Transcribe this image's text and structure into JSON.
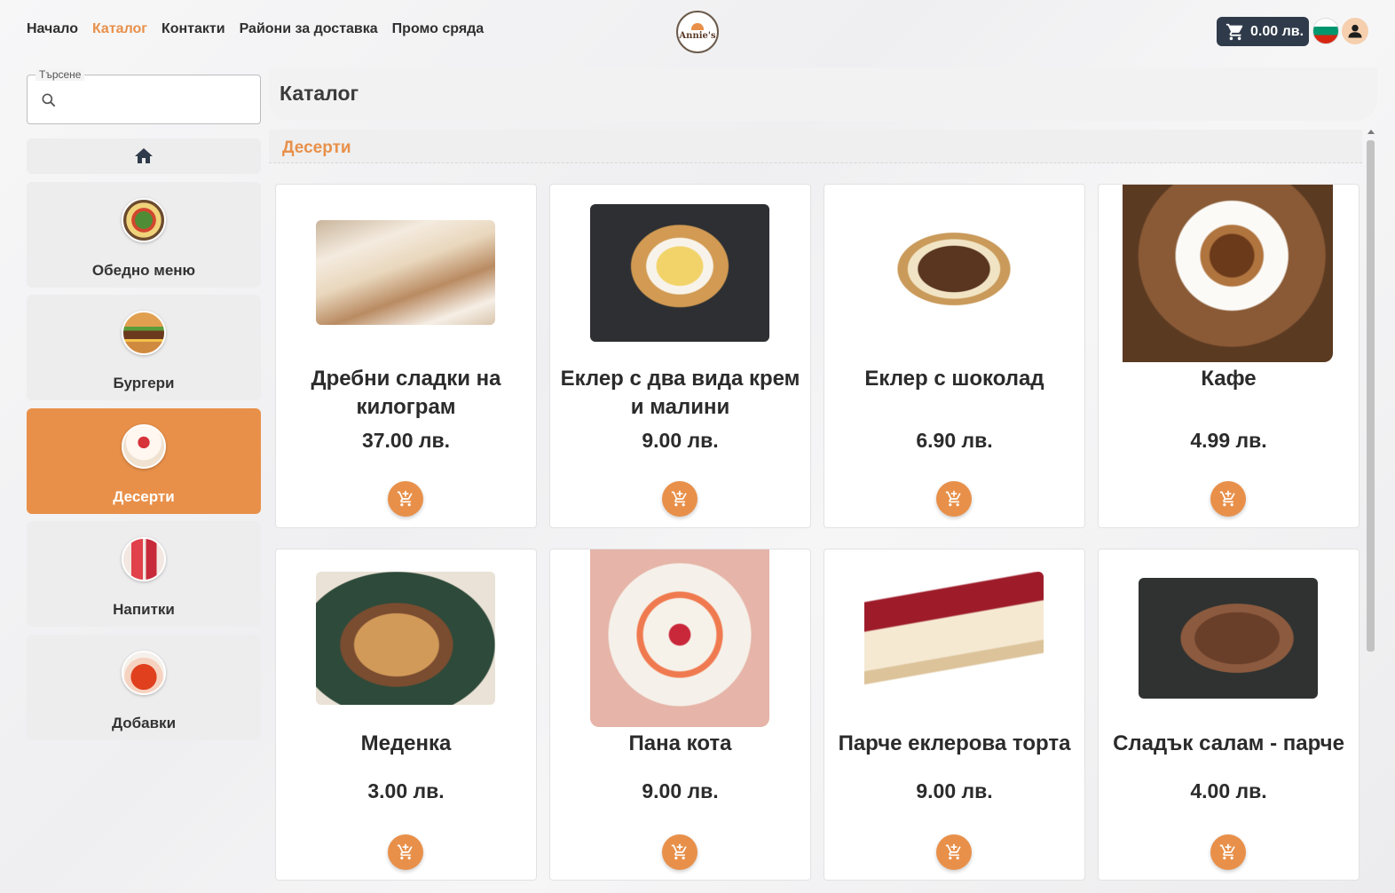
{
  "nav": {
    "items": [
      {
        "label": "Начало"
      },
      {
        "label": "Каталог"
      },
      {
        "label": "Контакти"
      },
      {
        "label": "Райони за доставка"
      },
      {
        "label": "Промо сряда"
      }
    ],
    "active_index": 1
  },
  "logo": {
    "text": "Annie's"
  },
  "cart": {
    "total": "0.00 лв.",
    "icon": "cart-icon"
  },
  "language": {
    "flag": "bulgaria-flag-icon"
  },
  "user": {
    "icon": "user-icon"
  },
  "search": {
    "label": "Търсене",
    "value": "",
    "placeholder": "",
    "icon": "search-icon"
  },
  "sidebar": {
    "home_icon": "home-icon",
    "items": [
      {
        "label": "Обедно меню",
        "icon": "lunch-menu-icon"
      },
      {
        "label": "Бургери",
        "icon": "burger-icon"
      },
      {
        "label": "Десерти",
        "icon": "dessert-icon",
        "active": true
      },
      {
        "label": "Напитки",
        "icon": "drinks-icon"
      },
      {
        "label": "Добавки",
        "icon": "extras-icon"
      }
    ]
  },
  "main": {
    "title": "Каталог",
    "section": "Десерти"
  },
  "products": [
    {
      "name": "Дребни сладки на килограм",
      "price": "37.00 лв."
    },
    {
      "name": "Еклер с два вида крем и малини",
      "price": "9.00 лв."
    },
    {
      "name": "Еклер с шоколад",
      "price": "6.90 лв."
    },
    {
      "name": "Кафе",
      "price": "4.99 лв."
    },
    {
      "name": "Меденка",
      "price": "3.00 лв."
    },
    {
      "name": "Пана кота",
      "price": "9.00 лв."
    },
    {
      "name": "Парче еклерова торта",
      "price": "9.00 лв."
    },
    {
      "name": "Сладък салам - парче",
      "price": "4.00 лв."
    }
  ],
  "colors": {
    "accent": "#e8904a",
    "cart_bg": "#2f3b4a",
    "card_bg": "#ffffff",
    "sidebar_bg": "#ededee"
  }
}
